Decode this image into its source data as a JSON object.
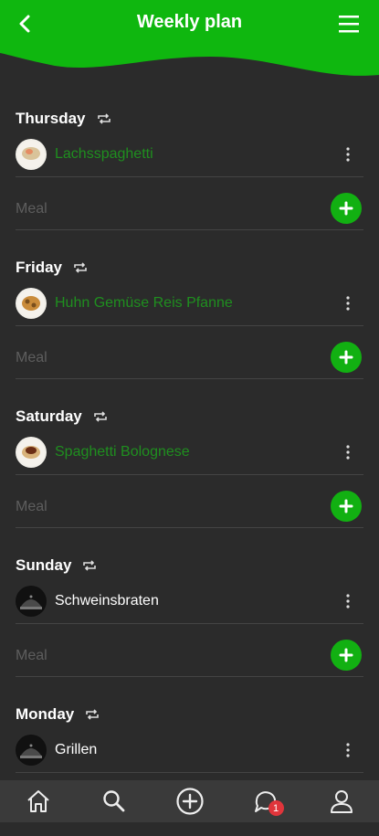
{
  "header": {
    "title": "Weekly plan",
    "accent": "#0fb70f"
  },
  "meal_placeholder": "Meal",
  "days": [
    {
      "name": "Thursday",
      "meal": "Lachsspaghetti",
      "linked": true,
      "thumb": "salmon-spaghetti-plate-icon"
    },
    {
      "name": "Friday",
      "meal": "Huhn Gemüse Reis Pfanne",
      "linked": true,
      "thumb": "chicken-rice-plate-icon"
    },
    {
      "name": "Saturday",
      "meal": "Spaghetti Bolognese",
      "linked": true,
      "thumb": "bolognese-plate-icon"
    },
    {
      "name": "Sunday",
      "meal": "Schweinsbraten",
      "linked": false,
      "thumb": "placeholder-dish-icon"
    },
    {
      "name": "Monday",
      "meal": "Grillen",
      "linked": false,
      "thumb": "placeholder-dish-icon"
    }
  ],
  "nav": {
    "items": [
      "home-icon",
      "search-icon",
      "add-circle-icon",
      "chat-icon",
      "profile-icon"
    ],
    "chat_badge": "1"
  }
}
